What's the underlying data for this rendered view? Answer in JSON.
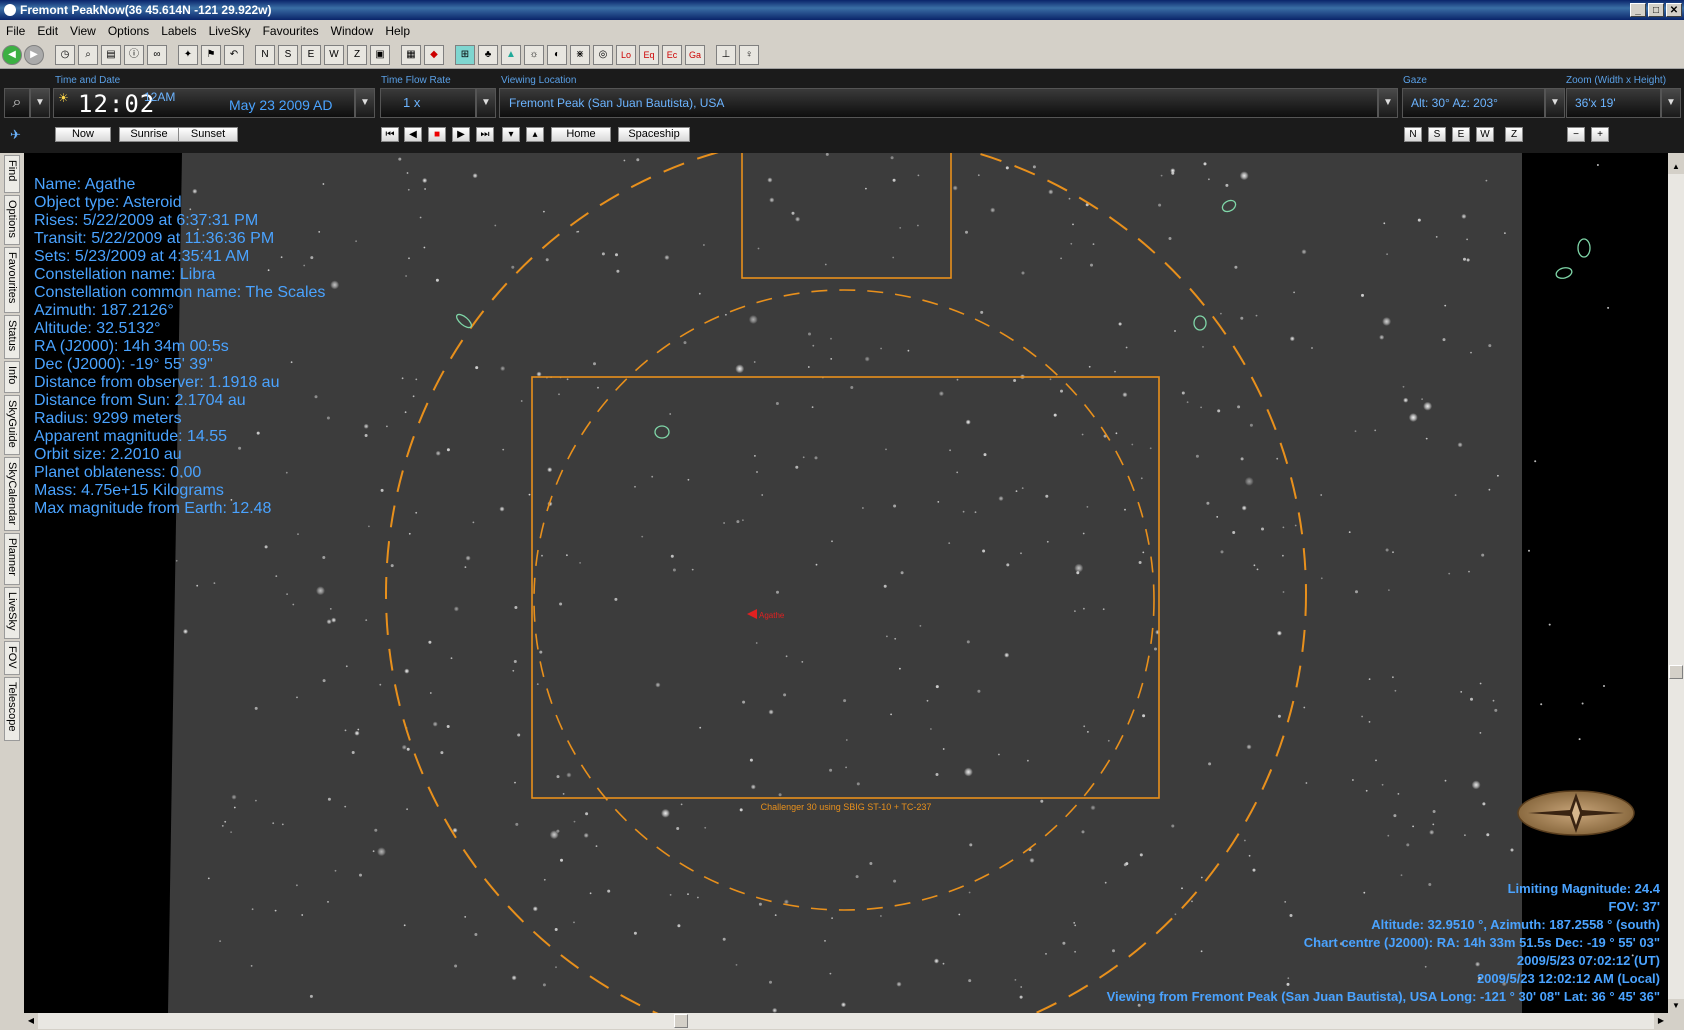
{
  "window": {
    "title": "Fremont PeakNow(36  45.614N -121 29.922w)",
    "controls": [
      "_",
      "□",
      "✕"
    ]
  },
  "menu": [
    "File",
    "Edit",
    "View",
    "Options",
    "Labels",
    "LiveSky",
    "Favourites",
    "Window",
    "Help"
  ],
  "panel": {
    "time_date_label": "Time and Date",
    "time": "12:02",
    "ampm": "12AM",
    "date": "May 23   2009 AD",
    "now_label": "Now",
    "sunrise_label": "Sunrise",
    "sunset_label": "Sunset",
    "time_flow_label": "Time Flow Rate",
    "time_flow_value": "1 x",
    "home_label": "Home",
    "spaceship_label": "Spaceship",
    "viewing_location_label": "Viewing Location",
    "viewing_location_value": "Fremont Peak (San Juan Bautista), USA",
    "gaze_label": "Gaze",
    "gaze_value": "Alt: 30° Az: 203°",
    "direction_buttons": [
      "N",
      "S",
      "E",
      "W",
      "Z"
    ],
    "zoom_label": "Zoom (Width x Height)",
    "zoom_value": "36'x 19'",
    "zoom_out": "−",
    "zoom_in": "+"
  },
  "side_tabs": [
    "Find",
    "Options",
    "Favourites",
    "Status",
    "Info",
    "SkyGuide",
    "SkyCalendar",
    "Planner",
    "LiveSky",
    "FOV",
    "Telescope"
  ],
  "object_info": [
    "Name: Agathe",
    "Object type: Asteroid",
    "Rises: 5/22/2009 at 6:37:31 PM",
    "Transit: 5/22/2009 at 11:36:36 PM",
    "Sets: 5/23/2009 at 4:35:41 AM",
    "Constellation name: Libra",
    "Constellation common name: The Scales",
    "Azimuth: 187.2126°",
    "Altitude: 32.5132°",
    "RA (J2000): 14h 34m 00.5s",
    "Dec (J2000): -19° 55' 39\"",
    "Distance from observer: 1.1918 au",
    "Distance from Sun: 2.1704 au",
    "Radius: 9299 meters",
    "Apparent magnitude: 14.55",
    "Orbit size: 2.2010 au",
    "Planet oblateness: 0.00",
    "Mass: 4.75e+15 Kilograms",
    "Max magnitude from Earth: 12.48"
  ],
  "fov_caption": "Challenger 30 using SBIG ST-10 + TC-237",
  "object_marker_label": "Agathe",
  "status_info": [
    "Limiting Magnitude: 24.4",
    "FOV: 37'",
    "Altitude: 32.9510 °, Azimuth: 187.2558 ° (south)",
    "Chart centre (J2000): RA: 14h 33m 51.5s Dec: -19 ° 55' 03\"",
    "2009/5/23 07:02:12 (UT)",
    "2009/5/23 12:02:12 AM (Local)",
    "Viewing from Fremont Peak (San Juan Bautista), USA    Long: -121 ° 30' 08\" Lat: 36 ° 45' 36\""
  ],
  "colors": {
    "overlay_text": "#4aa3ff",
    "fov_orange": "#e8901c",
    "galaxy_green": "#7fd6a8",
    "marker_red": "#e02020"
  }
}
